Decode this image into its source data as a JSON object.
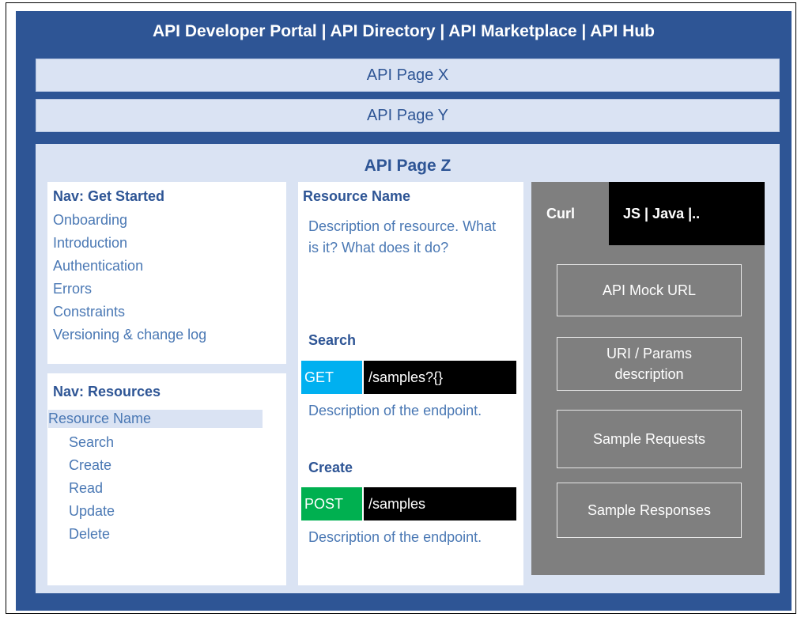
{
  "portal": {
    "title": "API Developer Portal | API Directory | API Marketplace | API Hub"
  },
  "pages": {
    "x": "API Page X",
    "y": "API Page Y",
    "z": "API Page Z"
  },
  "nav_get_started": {
    "heading": "Nav: Get Started",
    "items": [
      "Onboarding",
      "Introduction",
      "Authentication",
      "Errors",
      "Constraints",
      "Versioning & change log"
    ]
  },
  "nav_resources": {
    "heading": "Nav: Resources",
    "selected": "Resource Name",
    "items": [
      "Search",
      "Create",
      "Read",
      "Update",
      "Delete"
    ]
  },
  "resource": {
    "name": "Resource Name",
    "description": "Description of resource. What is it? What does it do?",
    "endpoints": [
      {
        "title": "Search",
        "method": "GET",
        "method_color": "#00b0f0",
        "path": "/samples?{}",
        "description": "Description of the endpoint."
      },
      {
        "title": "Create",
        "method": "POST",
        "method_color": "#00b050",
        "path": "/samples",
        "description": "Description of the endpoint."
      }
    ]
  },
  "code_panel": {
    "tab_active": "Curl",
    "tab_other": "JS | Java |..",
    "boxes": [
      "API Mock URL",
      "URI / Params description",
      "Sample Requests",
      "Sample Responses"
    ]
  }
}
